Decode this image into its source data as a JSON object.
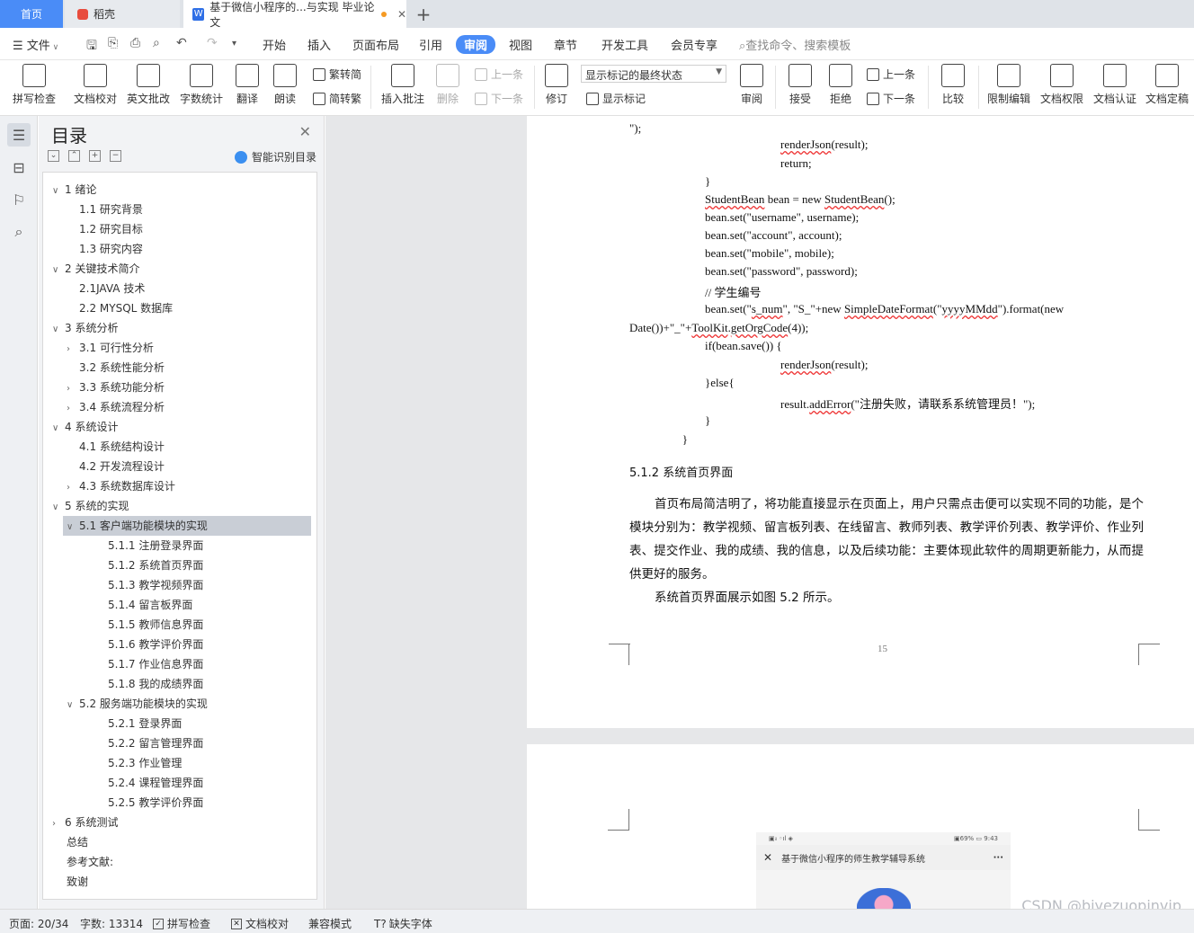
{
  "tabs": {
    "home": "首页",
    "doc1": "稻壳",
    "doc2": "基于微信小程序的...与实现 毕业论文",
    "add": "+"
  },
  "menu": {
    "file": "文件",
    "items": [
      "开始",
      "插入",
      "页面布局",
      "引用",
      "审阅",
      "视图",
      "章节",
      "开发工具",
      "会员专享"
    ],
    "active": "审阅",
    "search_placeholder": "查找命令、搜索模板"
  },
  "ribbon": {
    "spell": "拼写检查",
    "proof": "文档校对",
    "english": "英文批改",
    "count": "字数统计",
    "translate": "翻译",
    "read": "朗读",
    "trad": "繁转简",
    "simp": "简转繁",
    "insert_comment": "插入批注",
    "delete": "删除",
    "prev1": "上一条",
    "next1": "下一条",
    "revise": "修订",
    "markup_state": "显示标记的最终状态",
    "show_markup": "显示标记",
    "review": "审阅",
    "accept": "接受",
    "reject": "拒绝",
    "prev2": "上一条",
    "next2": "下一条",
    "compare": "比较",
    "restrict": "限制编辑",
    "permission": "文档权限",
    "certify": "文档认证",
    "finalize": "文档定稿"
  },
  "toc": {
    "title": "目录",
    "ai_label": "智能识别目录",
    "items": [
      {
        "label": "1  绪论",
        "level": 1,
        "chev": "v"
      },
      {
        "label": "1.1 研究背景",
        "level": 2,
        "chev": ""
      },
      {
        "label": "1.2 研究目标",
        "level": 2,
        "chev": ""
      },
      {
        "label": "1.3 研究内容",
        "level": 2,
        "chev": ""
      },
      {
        "label": "2  关键技术简介",
        "level": 1,
        "chev": "v"
      },
      {
        "label": "2.1JAVA 技术",
        "level": 2,
        "chev": ""
      },
      {
        "label": "2.2 MYSQL 数据库",
        "level": 2,
        "chev": ""
      },
      {
        "label": "3  系统分析",
        "level": 1,
        "chev": "v"
      },
      {
        "label": "3.1 可行性分析",
        "level": 2,
        "chev": ">"
      },
      {
        "label": "3.2 系统性能分析",
        "level": 2,
        "chev": ""
      },
      {
        "label": "3.3 系统功能分析",
        "level": 2,
        "chev": ">"
      },
      {
        "label": "3.4 系统流程分析",
        "level": 2,
        "chev": ">"
      },
      {
        "label": "4  系统设计",
        "level": 1,
        "chev": "v"
      },
      {
        "label": "4.1 系统结构设计",
        "level": 2,
        "chev": ""
      },
      {
        "label": "4.2 开发流程设计",
        "level": 2,
        "chev": ""
      },
      {
        "label": "4.3 系统数据库设计",
        "level": 2,
        "chev": ">"
      },
      {
        "label": "5  系统的实现",
        "level": 1,
        "chev": "v"
      },
      {
        "label": "5.1 客户端功能模块的实现",
        "level": 2,
        "chev": "v",
        "selected": true
      },
      {
        "label": "5.1.1 注册登录界面",
        "level": 3,
        "chev": ""
      },
      {
        "label": "5.1.2 系统首页界面",
        "level": 3,
        "chev": ""
      },
      {
        "label": "5.1.3 教学视频界面",
        "level": 3,
        "chev": ""
      },
      {
        "label": "5.1.4 留言板界面",
        "level": 3,
        "chev": ""
      },
      {
        "label": "5.1.5 教师信息界面",
        "level": 3,
        "chev": ""
      },
      {
        "label": "5.1.6 教学评价界面",
        "level": 3,
        "chev": ""
      },
      {
        "label": "5.1.7 作业信息界面",
        "level": 3,
        "chev": ""
      },
      {
        "label": "5.1.8 我的成绩界面",
        "level": 3,
        "chev": ""
      },
      {
        "label": "5.2 服务端功能模块的实现",
        "level": 2,
        "chev": "v"
      },
      {
        "label": "5.2.1 登录界面",
        "level": 3,
        "chev": ""
      },
      {
        "label": "5.2.2 留言管理界面",
        "level": 3,
        "chev": ""
      },
      {
        "label": "5.2.3 作业管理",
        "level": 3,
        "chev": ""
      },
      {
        "label": "5.2.4 课程管理界面",
        "level": 3,
        "chev": ""
      },
      {
        "label": "5.2.5 教学评价界面",
        "level": 3,
        "chev": ""
      },
      {
        "label": "6  系统测试",
        "level": 1,
        "chev": ">"
      },
      {
        "label": "总结",
        "level": 1,
        "chev": "",
        "plain": true
      },
      {
        "label": "参考文献:",
        "level": 1,
        "chev": "",
        "plain": true
      },
      {
        "label": "致谢",
        "level": 1,
        "chev": "",
        "plain": true
      }
    ]
  },
  "document": {
    "code_lines": [
      {
        "text": "\");",
        "indent": 0
      },
      {
        "text": "renderJson(result);",
        "indent": 2,
        "wavy": "renderJson"
      },
      {
        "text": "return;",
        "indent": 2
      },
      {
        "text": "}",
        "indent": 1
      },
      {
        "text": "StudentBean bean = new StudentBean();",
        "indent": 1,
        "wavy": "StudentBean"
      },
      {
        "text": "bean.set(\"username\", username);",
        "indent": 1
      },
      {
        "text": "bean.set(\"account\", account);",
        "indent": 1
      },
      {
        "text": "bean.set(\"mobile\", mobile);",
        "indent": 1
      },
      {
        "text": "bean.set(\"password\", password);",
        "indent": 1
      },
      {
        "text": "// 学生编号",
        "indent": 1
      },
      {
        "text": "bean.set(\"s_num\", \"S_\"+new SimpleDateFormat(\"yyyyMMdd\").format(new",
        "indent": 1
      },
      {
        "text": "Date())+\"_\"+ToolKit.getOrgCode(4));",
        "indent": 0
      },
      {
        "text": "if(bean.save()) {",
        "indent": 1
      },
      {
        "text": "renderJson(result);",
        "indent": 2
      },
      {
        "text": "}else{",
        "indent": 1
      },
      {
        "text": "result.addError(\"注册失败，请联系系统管理员！\");",
        "indent": 2
      },
      {
        "text": "}",
        "indent": 1
      },
      {
        "text": "}",
        "indent": 0.7
      }
    ],
    "heading": "5.1.2 系统首页界面",
    "paragraph": "首页布局简洁明了，将功能直接显示在页面上，用户只需点击便可以实现不同的功能，是个模块分别为：教学视频、留言板列表、在线留言、教师列表、教学评价列表、教学评价、作业列表、提交作业、我的成绩、我的信息，以及后续功能：主要体现此软件的周期更新能力，从而提供更好的服务。",
    "paragraph2": "系统首页界面展示如图 5.2 所示。",
    "page_number": "15",
    "phone": {
      "status_left": "▣ᵢₗ ◦ıl ◈",
      "status_right": "▣69% ▭ 9:43",
      "title": "基于微信小程序的师生教学辅导系统",
      "close": "✕",
      "more": "···"
    }
  },
  "statusbar": {
    "page": "页面: 20/34",
    "words": "字数: 13314",
    "spell": "拼写检查",
    "proof": "文档校对",
    "compat": "兼容模式",
    "missing_font": "缺失字体"
  },
  "watermark": "CSDN @biyezuopinvip"
}
